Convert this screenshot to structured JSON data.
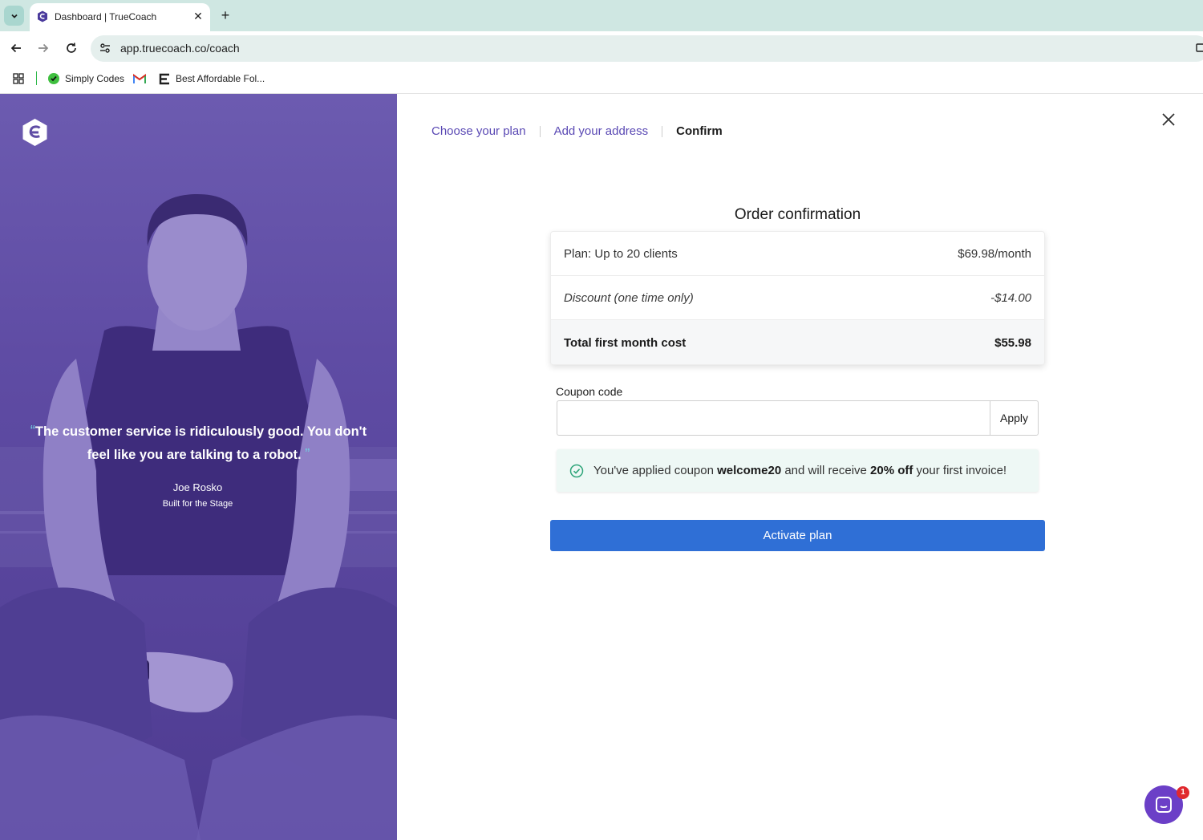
{
  "browser": {
    "tab_title": "Dashboard | TrueCoach",
    "tab_close": "✕",
    "new_tab": "+",
    "url": "app.truecoach.co/coach",
    "bookmarks": [
      {
        "label": "Simply Codes",
        "icon": "simply-codes-icon"
      },
      {
        "label": "",
        "icon": "gmail-icon"
      },
      {
        "label": "Best Affordable Fol...",
        "icon": "bookmark-e-icon"
      }
    ]
  },
  "hero": {
    "quote": "The customer service is ridiculously good. You don't feel like you are talking to a robot.",
    "open_quote": "“",
    "close_quote": "”",
    "author": "Joe Rosko",
    "company": "Built for the Stage"
  },
  "steps": {
    "choose_plan": "Choose your plan",
    "add_address": "Add your address",
    "confirm": "Confirm"
  },
  "order": {
    "title": "Order confirmation",
    "plan_label": "Plan: Up to 20 clients",
    "plan_price": "$69.98/month",
    "discount_label": "Discount (one time only)",
    "discount_value": "-$14.00",
    "total_label": "Total first month cost",
    "total_value": "$55.98"
  },
  "coupon": {
    "label": "Coupon code",
    "value": "",
    "placeholder": "",
    "apply_label": "Apply",
    "success_prefix": "You've applied coupon ",
    "code": "welcome20",
    "success_middle": " and will receive ",
    "discount": "20% off",
    "success_suffix": " your first invoice!"
  },
  "actions": {
    "activate_label": "Activate plan"
  },
  "chat": {
    "badge_count": "1"
  },
  "colors": {
    "brand_purple": "#5a49b4",
    "hero_bg": "#5f4ca4",
    "primary_button": "#2f6fd6",
    "success_bg": "#eef8f5",
    "success_icon": "#2fa57a"
  }
}
